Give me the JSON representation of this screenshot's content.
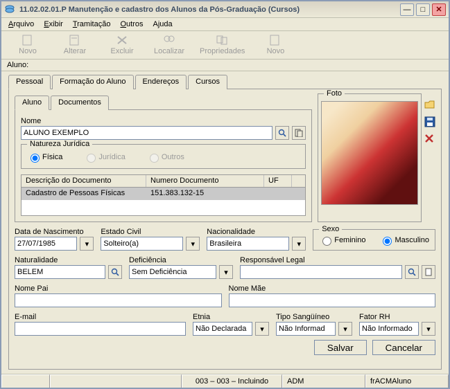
{
  "window": {
    "title": "11.02.02.01.P Manutenção e cadastro dos Alunos da Pós-Graduação (Cursos)"
  },
  "menu": {
    "arquivo": "Arquivo",
    "exibir": "Exibir",
    "tramitacao": "Tramitação",
    "outros": "Outros",
    "ajuda": "Ajuda"
  },
  "toolbar": {
    "novo": "Novo",
    "alterar": "Alterar",
    "excluir": "Excluir",
    "localizar": "Localizar",
    "propriedades": "Propriedades",
    "novo2": "Novo"
  },
  "aluno_label": "Aluno:",
  "tabs": {
    "pessoal": "Pessoal",
    "formacao": "Formação do Aluno",
    "enderecos": "Endereços",
    "cursos": "Cursos"
  },
  "subtabs": {
    "aluno": "Aluno",
    "documentos": "Documentos"
  },
  "nome": {
    "label": "Nome",
    "value": "ALUNO EXEMPLO"
  },
  "natureza": {
    "legend": "Natureza Jurídica",
    "fisica": "Física",
    "juridica": "Jurídica",
    "outros": "Outros"
  },
  "doc": {
    "h1": "Descrição do Documento",
    "h2": "Numero Documento",
    "h3": "UF",
    "r1c1": "Cadastro de Pessoas Físicas",
    "r1c2": "151.383.132-15",
    "r1c3": ""
  },
  "foto": {
    "legend": "Foto"
  },
  "nasc": {
    "label": "Data de Nascimento",
    "value": "27/07/1985"
  },
  "ecivil": {
    "label": "Estado Civil",
    "value": "Solteiro(a)"
  },
  "nac": {
    "label": "Nacionalidade",
    "value": "Brasileira"
  },
  "sexo": {
    "legend": "Sexo",
    "fem": "Feminino",
    "masc": "Masculino"
  },
  "nat": {
    "label": "Naturalidade",
    "value": "BELEM"
  },
  "def": {
    "label": "Deficiência",
    "value": "Sem Deficiência"
  },
  "resp": {
    "label": "Responsável Legal",
    "value": ""
  },
  "pai": {
    "label": "Nome Pai",
    "value": ""
  },
  "mae": {
    "label": "Nome Mãe",
    "value": ""
  },
  "email": {
    "label": "E-mail",
    "value": ""
  },
  "etnia": {
    "label": "Etnia",
    "value": "Não Declarada"
  },
  "sang": {
    "label": "Tipo Sangüíneo",
    "value": "Não Informad"
  },
  "rh": {
    "label": "Fator RH",
    "value": "Não Informado"
  },
  "buttons": {
    "salvar": "Salvar",
    "cancelar": "Cancelar"
  },
  "status": {
    "s3": "003 – 003 – Incluindo",
    "s4": "ADM",
    "s5": "frACMAluno"
  }
}
